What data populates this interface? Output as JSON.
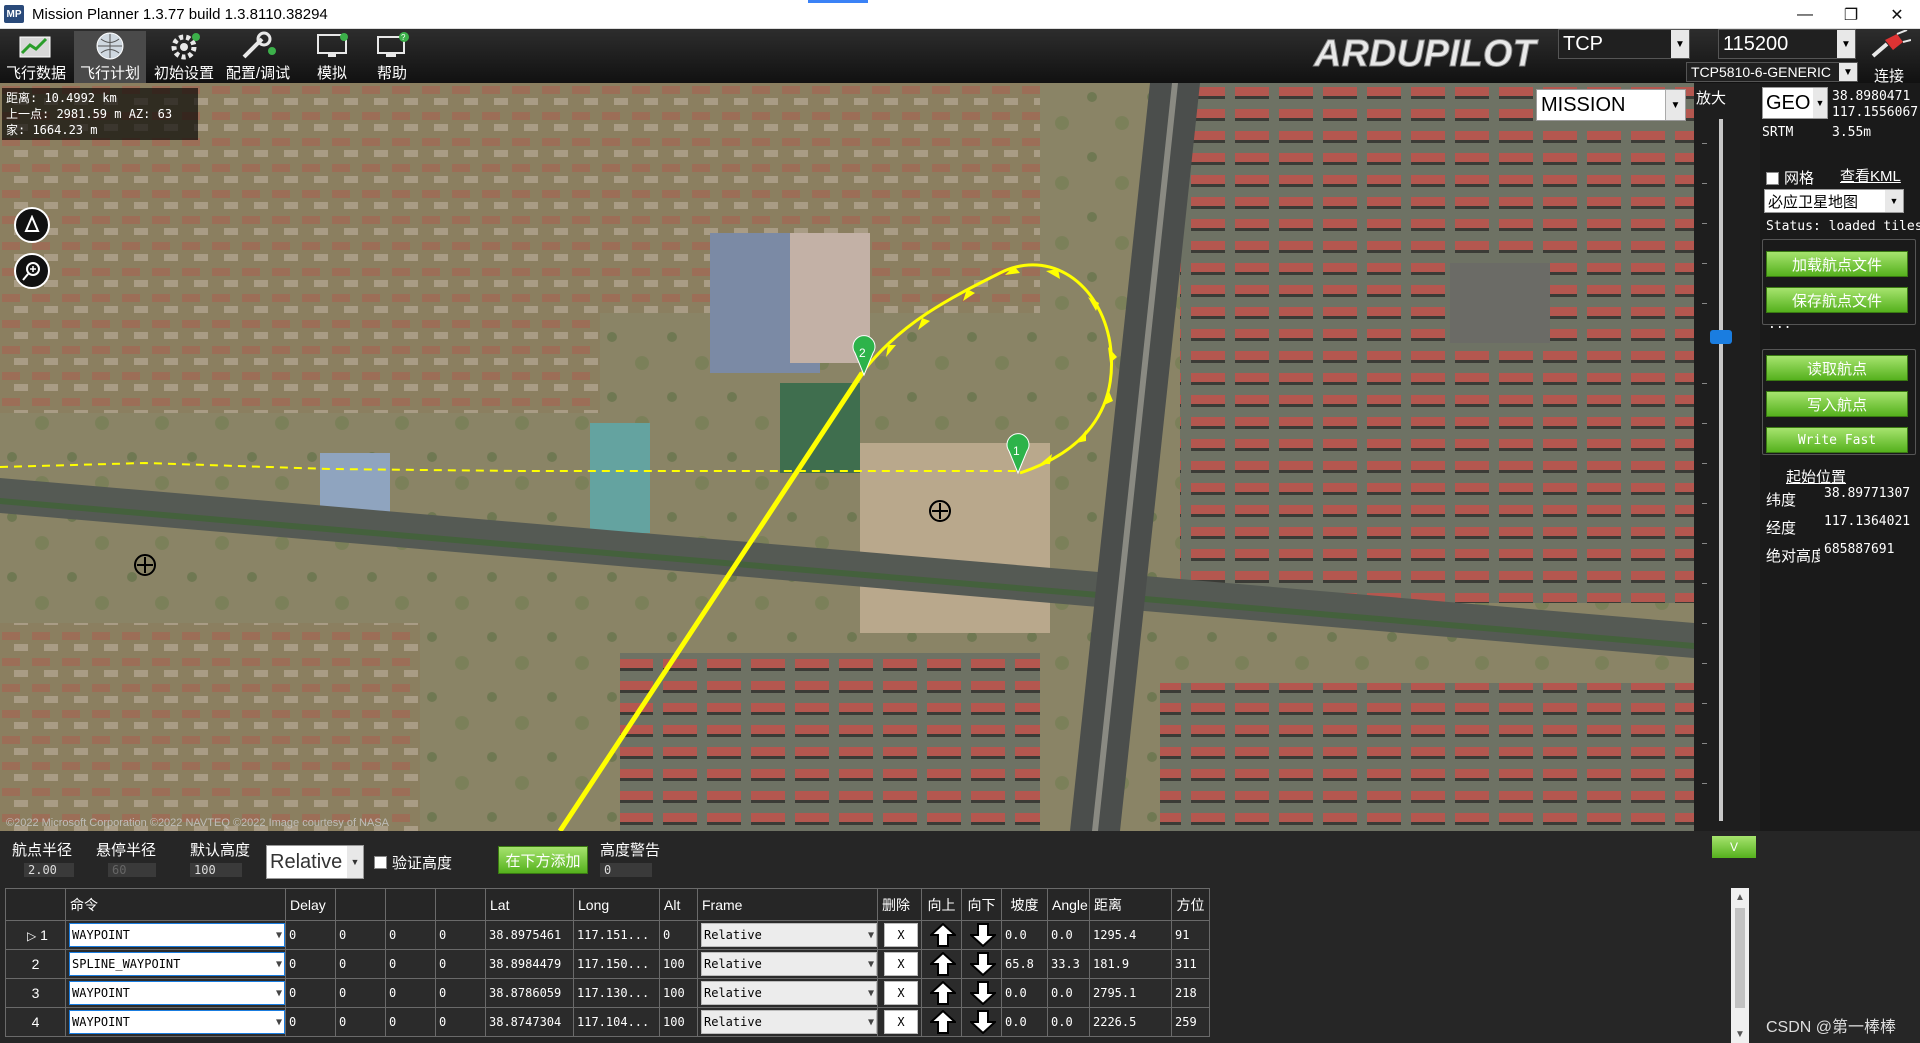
{
  "window": {
    "title": "Mission Planner 1.3.77 build 1.3.8110.38294",
    "icon": "MP",
    "minimize": "—",
    "restore": "❐",
    "close": "✕"
  },
  "toolbar": {
    "items": [
      {
        "label": "飞行数据",
        "icon": "flight-data-icon"
      },
      {
        "label": "飞行计划",
        "icon": "flight-plan-icon"
      },
      {
        "label": "初始设置",
        "icon": "initial-setup-icon"
      },
      {
        "label": "配置/调试",
        "icon": "config-tuning-icon"
      },
      {
        "label": "模拟",
        "icon": "simulation-icon"
      },
      {
        "label": "帮助",
        "icon": "help-icon"
      }
    ],
    "logo": "ARDUPILOT",
    "connection_type": "TCP",
    "baud_rate": "115200",
    "device": "TCP5810-6-GENERIC",
    "connect_label": "连接"
  },
  "map": {
    "info": {
      "distance": "距离: 10.4992 km",
      "last_point": "上一点: 2981.59 m AZ: 63",
      "home": "家: 1664.23 m"
    },
    "mode": "MISSION",
    "copyright": "©2022 Microsoft Corporation ©2022 NAVTEQ ©2022 Image courtesy of NASA",
    "waypoint_labels": [
      "1",
      "2"
    ],
    "accent_path": "#ffff00",
    "wp_marker_color": "#2db34a"
  },
  "zoom": {
    "label": "放大"
  },
  "right_panel": {
    "geo_combo": "GEO",
    "lat": "38.8980471",
    "lng": "117.1556067",
    "srtm_label": "SRTM",
    "srtm_value": "3.55m",
    "grid_label": "网格",
    "view_kml": "查看KML",
    "map_type": "必应卫星地图",
    "status": "Status: loaded tiles",
    "load_wp_file": "加载航点文件",
    "save_wp_file": "保存航点文件",
    "dots": "...",
    "read_wp": "读取航点",
    "write_wp": "写入航点",
    "write_fast": "Write Fast",
    "home_position": "起始位置",
    "home_lat_label": "纬度",
    "home_lat": "38.89771307",
    "home_lng_label": "经度",
    "home_lng": "117.1364021",
    "home_alt_label": "绝对高度",
    "home_alt": "685887691"
  },
  "bottom": {
    "wp_radius_label": "航点半径",
    "wp_radius": "2.00",
    "loiter_radius_label": "悬停半径",
    "loiter_radius": "60",
    "default_alt_label": "默认高度",
    "default_alt": "100",
    "frame_combo": "Relative",
    "verify_alt_label": "验证高度",
    "add_below": "在下方添加",
    "alt_warning_label": "高度警告",
    "alt_warning": "0",
    "collapse": "V",
    "watermark": "CSDN @第一棒棒"
  },
  "table": {
    "headers": [
      "",
      "命令",
      "Delay",
      "",
      "",
      "",
      "Lat",
      "Long",
      "Alt",
      "Frame",
      "删除",
      "向上",
      "向下",
      "坡度",
      "Angle",
      "距离",
      "方位"
    ],
    "rows": [
      {
        "no": "1",
        "cmd": "WAYPOINT",
        "delay": "0",
        "p2": "0",
        "p3": "0",
        "p4": "0",
        "lat": "38.8975461",
        "lng": "117.151...",
        "alt": "0",
        "frame": "Relative",
        "del": "X",
        "grad": "0.0",
        "angle": "0.0",
        "dist": "1295.4",
        "az": "91"
      },
      {
        "no": "2",
        "cmd": "SPLINE_WAYPOINT",
        "delay": "0",
        "p2": "0",
        "p3": "0",
        "p4": "0",
        "lat": "38.8984479",
        "lng": "117.150...",
        "alt": "100",
        "frame": "Relative",
        "del": "X",
        "grad": "65.8",
        "angle": "33.3",
        "dist": "181.9",
        "az": "311"
      },
      {
        "no": "3",
        "cmd": "WAYPOINT",
        "delay": "0",
        "p2": "0",
        "p3": "0",
        "p4": "0",
        "lat": "38.8786059",
        "lng": "117.130...",
        "alt": "100",
        "frame": "Relative",
        "del": "X",
        "grad": "0.0",
        "angle": "0.0",
        "dist": "2795.1",
        "az": "218"
      },
      {
        "no": "4",
        "cmd": "WAYPOINT",
        "delay": "0",
        "p2": "0",
        "p3": "0",
        "p4": "0",
        "lat": "38.8747304",
        "lng": "117.104...",
        "alt": "100",
        "frame": "Relative",
        "del": "X",
        "grad": "0.0",
        "angle": "0.0",
        "dist": "2226.5",
        "az": "259"
      }
    ]
  }
}
